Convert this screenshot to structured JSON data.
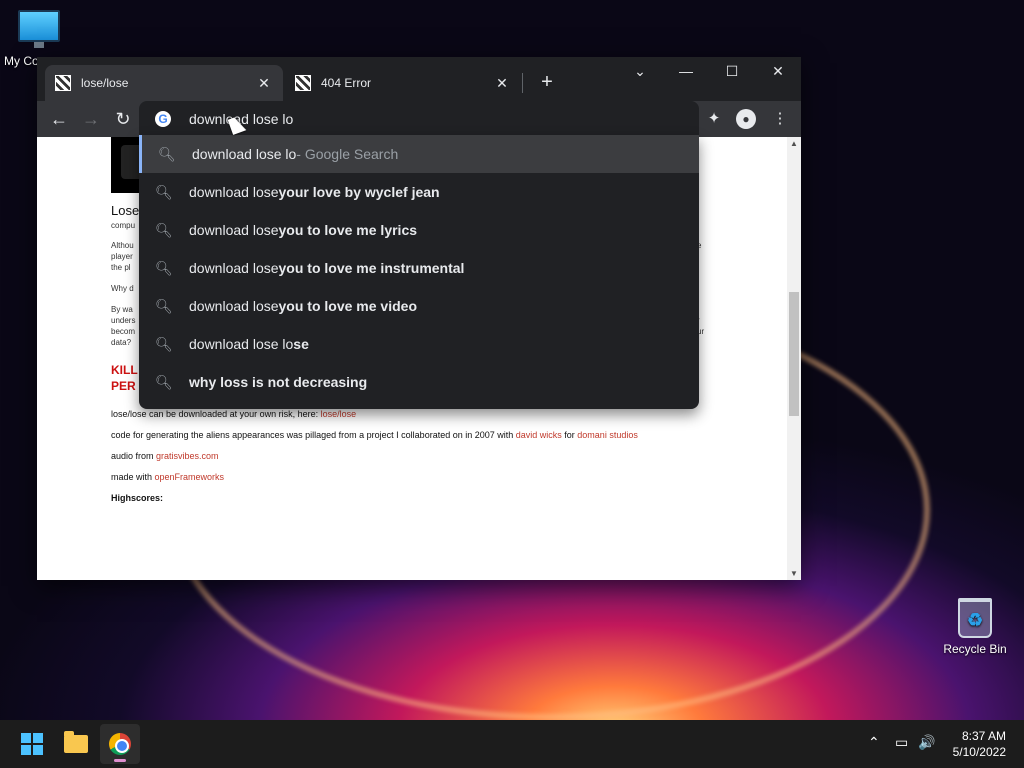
{
  "desktop": {
    "icons": [
      {
        "label": "My Co"
      },
      {
        "label": "Recycle Bin"
      }
    ]
  },
  "browser": {
    "tabs": [
      {
        "title": "lose/lose",
        "close": "✕"
      },
      {
        "title": "404 Error",
        "close": "✕"
      }
    ],
    "newtab_glyph": "+",
    "controls": {
      "tabsearch": "⌄",
      "minimize": "—",
      "maximize": "☐",
      "close": "✕"
    },
    "nav": {
      "back": "←",
      "forward": "→",
      "reload": "↻"
    },
    "omnibox": {
      "value": "download lose lo",
      "logo": "G"
    },
    "toolbar_icons": {
      "extensions": "✦",
      "profile": "●",
      "menu": "⋮"
    }
  },
  "suggestions": [
    {
      "prefix": "download lose lo",
      "bold": "",
      "hint": " - Google Search",
      "selected": true
    },
    {
      "prefix": "download lose ",
      "bold": "your love by wyclef jean",
      "hint": "",
      "selected": false
    },
    {
      "prefix": "download lose ",
      "bold": "you to love me lyrics",
      "hint": "",
      "selected": false
    },
    {
      "prefix": "download lose ",
      "bold": "you to love me instrumental",
      "hint": "",
      "selected": false
    },
    {
      "prefix": "download lose ",
      "bold": "you to love me video",
      "hint": "",
      "selected": false
    },
    {
      "prefix": "download lose lo",
      "bold": "se",
      "hint": "",
      "selected": false
    },
    {
      "prefix": "",
      "bold": "why loss is not decreasing",
      "hint": "",
      "selected": false
    }
  ],
  "page": {
    "heading": "Lose",
    "sub": "compu",
    "frags": [
      "Althou",
      "player",
      "the pl",
      "Why d",
      "By wa",
      "unders",
      "becom",
      "data?"
    ],
    "right_frags": [
      "e",
      "r",
      "ur"
    ],
    "kill": [
      "KILL",
      "PER"
    ],
    "lines": [
      {
        "text": "lose/lose can be downloaded at your own risk, here: ",
        "link": "lose/lose",
        "text2": "",
        "link2": ""
      },
      {
        "text": "code for generating the aliens appearances was pillaged from a project I collaborated on in 2007 with ",
        "link": "david wicks",
        "text2": " for ",
        "link2": "domani studios"
      },
      {
        "text": "audio from ",
        "link": "gratisvibes.com",
        "text2": "",
        "link2": ""
      },
      {
        "text": "made with ",
        "link": "openFrameworks",
        "text2": "",
        "link2": ""
      }
    ],
    "highscores": "Highscores:"
  },
  "taskbar": {
    "tray": {
      "chevron": "⌃",
      "network": "▭",
      "volume": "🔊"
    },
    "time": "8:37 AM",
    "date": "5/10/2022"
  }
}
